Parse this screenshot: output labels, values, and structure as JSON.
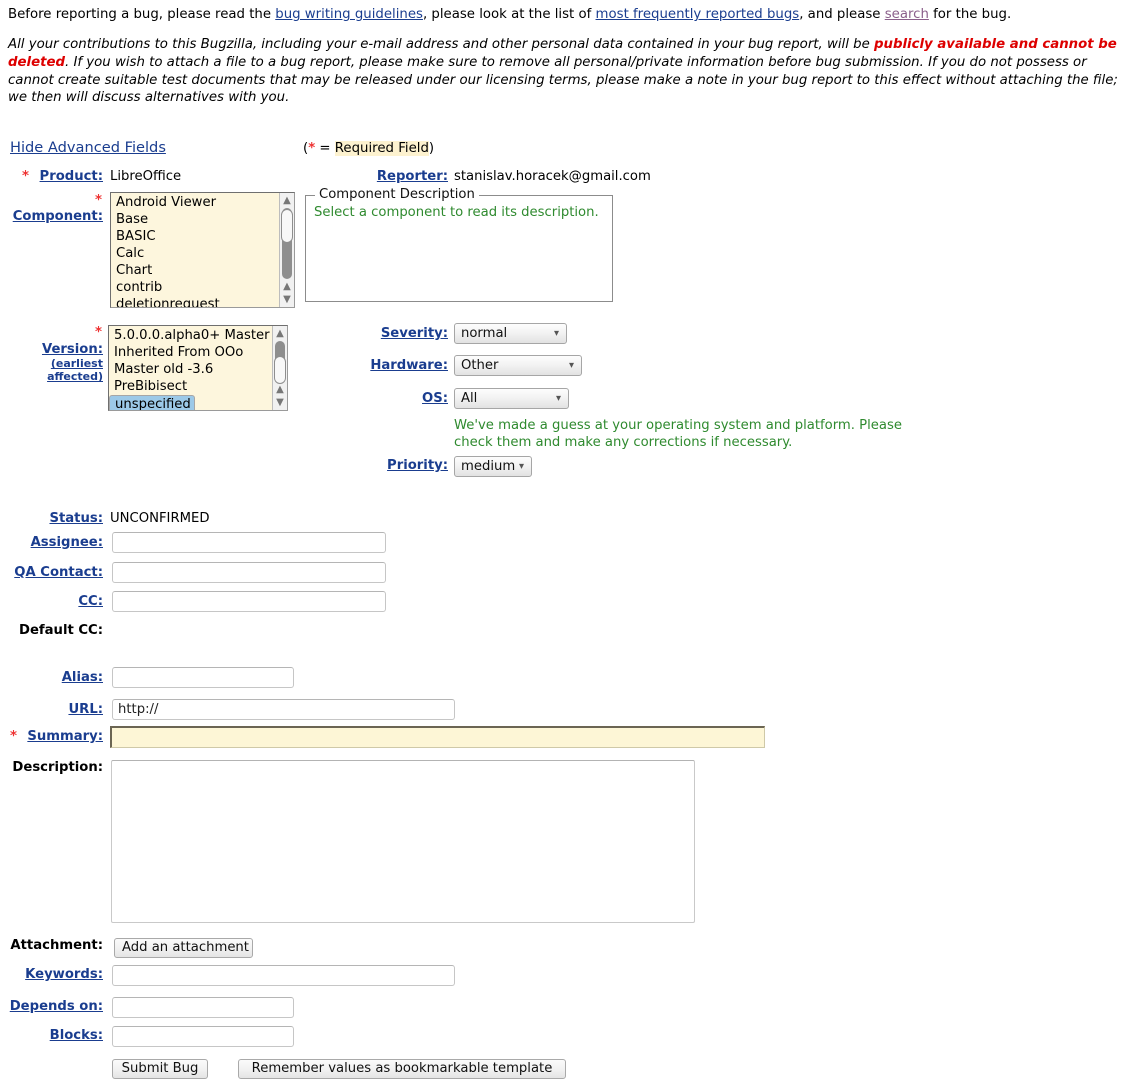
{
  "intro": {
    "line1_a": "Before reporting a bug, please read the ",
    "link_guidelines": "bug writing guidelines",
    "line1_b": ", please look at the list of ",
    "link_frequent": "most frequently reported bugs",
    "line1_c": ", and please ",
    "link_search": "search",
    "line1_d": " for the bug.",
    "warn_a": "All your contributions to this Bugzilla, including your e-mail address and other personal data contained in your bug report, will be ",
    "warn_bold": "publicly available and cannot be deleted",
    "warn_b": ". If you wish to attach a file to a bug report, please make sure to remove all personal/private information before bug submission. If you do not possess or cannot create suitable test documents that may be released under our licensing terms, please make a note in your bug report to this effect without attaching the file; we then will discuss alternatives with you."
  },
  "advanced": {
    "toggle_label": "Hide Advanced Fields",
    "required_note_open": "(",
    "required_note_star": "*",
    "required_note_eq": " = ",
    "required_note_text": "Required Field",
    "required_note_close": ")"
  },
  "fields": {
    "product_label": "Product:",
    "product_value": "LibreOffice",
    "reporter_label": "Reporter:",
    "reporter_value": "stanislav.horacek@gmail.com",
    "component_label": "Component:",
    "component_desc_legend": "Component Description",
    "component_desc_text": "Select a component to read its description.",
    "version_label": "Version:",
    "version_sub1": "(earliest",
    "version_sub2": "affected)",
    "severity_label": "Severity:",
    "severity_value": "normal",
    "hardware_label": "Hardware:",
    "hardware_value": "Other",
    "os_label": "OS:",
    "os_value": "All",
    "os_note": "We've made a guess at your operating system and platform. Please check them and make any corrections if necessary.",
    "priority_label": "Priority:",
    "priority_value": "medium",
    "status_label": "Status:",
    "status_value": "UNCONFIRMED",
    "assignee_label": "Assignee:",
    "assignee_value": "",
    "qa_contact_label": "QA Contact:",
    "qa_contact_value": "",
    "cc_label": "CC:",
    "cc_value": "",
    "default_cc_label": "Default CC:",
    "alias_label": "Alias:",
    "alias_value": "",
    "url_label": "URL:",
    "url_value": "http://",
    "summary_label": "Summary:",
    "summary_value": "",
    "description_label": "Description:",
    "description_value": "",
    "attachment_label": "Attachment:",
    "attachment_button": "Add an attachment",
    "keywords_label": "Keywords:",
    "keywords_value": "",
    "depends_label": "Depends on:",
    "depends_value": "",
    "blocks_label": "Blocks:",
    "blocks_value": "",
    "submit_button": "Submit Bug",
    "remember_button": "Remember values as bookmarkable template"
  },
  "component_options": [
    "Android Viewer",
    "Base",
    "BASIC",
    "Calc",
    "Chart",
    "contrib",
    "deletionrequest"
  ],
  "version_options": [
    "5.0.0.0.alpha0+ Master",
    "Inherited From OOo",
    "Master old -3.6",
    "PreBibisect",
    "unspecified"
  ],
  "version_selected": "unspecified",
  "icons": {
    "scroll_up": "⌃",
    "scroll_down": "⌄",
    "chevron_down": "⌄"
  },
  "colors": {
    "link": "#1a3d8f",
    "visited_link": "#8b5f8b",
    "required_star": "#ee3333",
    "warning_red": "#dd0000",
    "green_note": "#2f8a2f",
    "highlight_cream": "#fdf6dd",
    "selected_blue": "#9cc9e8"
  }
}
